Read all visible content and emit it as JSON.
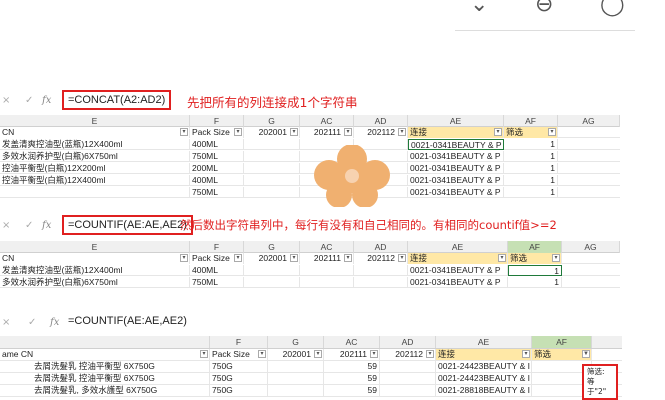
{
  "topbar": {
    "glyphs": [
      "⌄",
      "⊖",
      "◯"
    ]
  },
  "shot1": {
    "formula": "=CONCAT(A2:AD2)",
    "annotation": "先把所有的列连接成1个字符串",
    "headers": [
      "E",
      "F",
      "G",
      "AC",
      "AD",
      "AE",
      "AF",
      "AG"
    ],
    "colheads": [
      "CN",
      "Pack Size",
      "202001",
      "202111",
      "202112",
      "连接",
      "筛选"
    ],
    "rows": [
      [
        "发盖清爽控油型(蓝瓶)12X400ml",
        "400ML",
        "",
        "",
        "",
        "0021-0341BEAUTY & P",
        "1"
      ],
      [
        "多效水润养护型(白瓶)6X750ml",
        "750ML",
        "",
        "",
        "",
        "0021-0341BEAUTY & P",
        "1"
      ],
      [
        "控油平衡型(白瓶)12X200ml",
        "200ML",
        "",
        "",
        "",
        "0021-0341BEAUTY & P",
        "1"
      ],
      [
        "控油平衡型(白瓶)12X400ml",
        "400ML",
        "",
        "",
        "",
        "0021-0341BEAUTY & P",
        "1"
      ],
      [
        "",
        "750ML",
        "",
        "",
        "",
        "0021-0341BEAUTY & P",
        "1"
      ]
    ]
  },
  "shot2": {
    "formula": "=COUNTIF(AE:AE,AE2)",
    "annotation": "然后数出字符串列中，每行有没有和自己相同的。有相同的countif值>=2",
    "headers": [
      "E",
      "F",
      "G",
      "AC",
      "AD",
      "AE",
      "AF",
      "AG"
    ],
    "colheads": [
      "CN",
      "Pack Size",
      "202001",
      "202111",
      "202112",
      "连接",
      "筛选"
    ],
    "rows": [
      [
        "发盖清爽控油型(蓝瓶)12X400ml",
        "400ML",
        "",
        "",
        "",
        "0021-0341BEAUTY & P",
        "1"
      ],
      [
        "多效水润养护型(白瓶)6X750ml",
        "750ML",
        "",
        "",
        "",
        "0021-0341BEAUTY & P",
        "1"
      ]
    ]
  },
  "shot3": {
    "formula": "=COUNTIF(AE:AE,AE2)",
    "headers": [
      "F",
      "G",
      "AC",
      "AD",
      "AE",
      "AF"
    ],
    "colheads": [
      "ame CN",
      "Pack Size",
      "202001",
      "202111",
      "202112",
      "连接",
      "筛选"
    ],
    "rows": [
      [
        "去屑洗髮乳 控油平衡型 6X750G",
        "750G",
        "",
        "59",
        "",
        "0021-24423BEAUTY & I",
        ""
      ],
      [
        "去屑洗髮乳 控油平衡型 6X750G",
        "750G",
        "",
        "59",
        "",
        "0021-24423BEAUTY & I",
        ""
      ],
      [
        "去屑洗髮乳, 多效水護型 6X750G",
        "750G",
        "",
        "59",
        "",
        "0021-28818BEAUTY & I",
        ""
      ]
    ],
    "tooltip": {
      "line1": "筛选:",
      "line2": "等于\"2\""
    }
  }
}
